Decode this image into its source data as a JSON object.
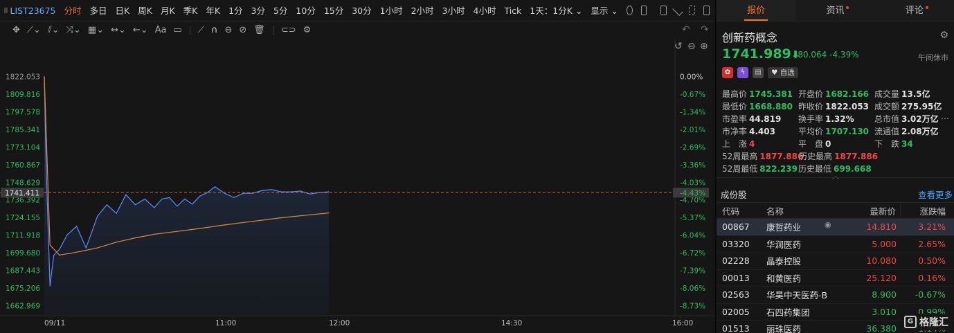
{
  "toolbar": {
    "symbol": "LIST23675",
    "periods": [
      "分时",
      "多日",
      "日K",
      "周K",
      "月K",
      "季K",
      "年K",
      "1分",
      "3分",
      "5分",
      "10分",
      "15分",
      "30分",
      "1小时",
      "2小时",
      "3小时",
      "4小时",
      "Tick"
    ],
    "active_period": "分时",
    "dot_periods": [
      "2小时",
      "Tick"
    ],
    "combo": "1天：1分K",
    "display": "显示"
  },
  "drawing_tools": [
    "move",
    "line",
    "channel",
    "fib",
    "measure",
    "range",
    "arrow",
    "text",
    "comment",
    "ruler",
    "magnet",
    "visibility",
    "hide",
    "delete",
    "link",
    "settings"
  ],
  "chart": {
    "x_labels": [
      "09/11",
      "11:00",
      "12:00",
      "14:30",
      "16:00"
    ],
    "y_labels": [
      "1822.053",
      "1809.816",
      "1797.578",
      "1785.341",
      "1773.104",
      "1760.867",
      "1748.629",
      "1736.392",
      "1724.155",
      "1711.918",
      "1699.680",
      "1687.443",
      "1675.206",
      "1662.969"
    ],
    "pct_labels": [
      "0.00%",
      "-0.67%",
      "-1.34%",
      "-2.01%",
      "-2.69%",
      "-3.36%",
      "-4.03%",
      "-4.70%",
      "-5.37%",
      "-6.04%",
      "-6.72%",
      "-7.39%",
      "-8.06%",
      "-8.73%"
    ],
    "current_price_label": "1741.411",
    "current_pct_label": "-4.43%",
    "colors": {
      "price_line": "#5b8cff",
      "avg_line": "#e08a3a",
      "cur_line": "#d0602a",
      "pos": "#f04848",
      "neg": "#2ebd63"
    }
  },
  "chart_data": {
    "type": "line",
    "title": "",
    "xlabel": "",
    "ylabel": "",
    "ylim": [
      1656.85,
      1828.17
    ],
    "x_ticks": [
      "09/11",
      "11:00",
      "12:00",
      "14:30",
      "16:00"
    ],
    "series": [
      {
        "name": "",
        "x": [
          "09:30",
          "09:31",
          "09:33",
          "09:35",
          "09:38",
          "09:42",
          "09:47",
          "09:52",
          "09:58",
          "10:03",
          "10:08",
          "10:13",
          "10:18",
          "10:23",
          "10:28",
          "10:32",
          "10:36",
          "10:40",
          "10:44",
          "10:48",
          "10:52",
          "10:56",
          "11:00",
          "11:05",
          "11:10",
          "11:15",
          "11:20",
          "11:25",
          "11:30",
          "11:35",
          "11:40",
          "11:45",
          "11:50",
          "11:55",
          "12:00"
        ],
        "values": [
          1822.0,
          1760.0,
          1676.5,
          1698.0,
          1702.0,
          1712.0,
          1718.0,
          1703.0,
          1725.0,
          1733.0,
          1727.0,
          1740.0,
          1733.0,
          1737.0,
          1731.0,
          1737.0,
          1738.0,
          1732.0,
          1737.0,
          1733.5,
          1739.0,
          1741.5,
          1745.5,
          1741.0,
          1738.0,
          1741.0,
          1741.0,
          1743.0,
          1743.5,
          1742.0,
          1742.0,
          1742.5,
          1740.5,
          1741.5,
          1742.0
        ]
      },
      {
        "name": "",
        "x": [
          "09:30",
          "09:33",
          "09:38",
          "09:47",
          "09:58",
          "10:08",
          "10:18",
          "10:28",
          "10:40",
          "10:52",
          "11:05",
          "11:20",
          "11:35",
          "11:50",
          "12:00"
        ],
        "values": [
          1822.0,
          1705.0,
          1698.0,
          1700.0,
          1703.0,
          1707.0,
          1710.0,
          1712.5,
          1714.5,
          1716.5,
          1719.0,
          1721.5,
          1724.0,
          1726.0,
          1727.3
        ]
      }
    ]
  },
  "tabs": [
    {
      "label": "报价",
      "dot": false
    },
    {
      "label": "资讯",
      "dot": true
    },
    {
      "label": "评论",
      "dot": true
    }
  ],
  "quote": {
    "name": "创新药概念",
    "price": "1741.989",
    "change": "-80.064",
    "change_pct": "-4.39%",
    "status": "午间休市",
    "watch_label": "自选",
    "stats": [
      [
        {
          "k": "最高价",
          "v": "1745.381",
          "c": "dn"
        },
        {
          "k": "开盘价",
          "v": "1682.166",
          "c": "dn"
        },
        {
          "k": "成交量",
          "v": "13.5亿",
          "c": "wh"
        }
      ],
      [
        {
          "k": "最低价",
          "v": "1668.880",
          "c": "dn"
        },
        {
          "k": "昨收价",
          "v": "1822.053",
          "c": "wh"
        },
        {
          "k": "成交额",
          "v": "275.95亿",
          "c": "wh"
        }
      ],
      [
        {
          "k": "市盈率",
          "v": "44.819",
          "c": "wh"
        },
        {
          "k": "换手率",
          "v": "1.32%",
          "c": "wh"
        },
        {
          "k": "总市值",
          "v": "3.02万亿",
          "c": "wh"
        }
      ],
      [
        {
          "k": "市净率",
          "v": "4.403",
          "c": "wh"
        },
        {
          "k": "平均价",
          "v": "1707.130",
          "c": "dn"
        },
        {
          "k": "流通值",
          "v": "2.08万亿",
          "c": "wh"
        }
      ],
      [
        {
          "k": "上　涨",
          "v": "4",
          "c": "up"
        },
        {
          "k": "平　盘",
          "v": "0",
          "c": "wh"
        },
        {
          "k": "下　跌",
          "v": "34",
          "c": "dn"
        }
      ],
      [
        {
          "k": "52周最高",
          "v": "1877.886",
          "c": "up"
        },
        {
          "k": "历史最高",
          "v": "1877.886",
          "c": "up"
        },
        {
          "k": "",
          "v": "",
          "c": "wh"
        }
      ],
      [
        {
          "k": "52周最低",
          "v": "822.239",
          "c": "dn"
        },
        {
          "k": "历史最低",
          "v": "699.668",
          "c": "dn"
        },
        {
          "k": "",
          "v": "",
          "c": "wh"
        }
      ]
    ]
  },
  "constituents": {
    "title": "成份股",
    "more": "查看更多",
    "headers": [
      "代码",
      "名称",
      "最新价",
      "涨跌幅"
    ],
    "rows": [
      {
        "code": "00867",
        "name": "康哲药业",
        "price": "14.810",
        "pct": "3.21%",
        "c": "up",
        "sel": true
      },
      {
        "code": "03320",
        "name": "华润医药",
        "price": "5.000",
        "pct": "2.65%",
        "c": "up",
        "sel": false
      },
      {
        "code": "02228",
        "name": "晶泰控股",
        "price": "10.080",
        "pct": "0.50%",
        "c": "up",
        "sel": false
      },
      {
        "code": "00013",
        "name": "和黄医药",
        "price": "25.120",
        "pct": "0.16%",
        "c": "up",
        "sel": false
      },
      {
        "code": "02563",
        "name": "华昊中天医药-B",
        "price": "8.900",
        "pct": "-0.67%",
        "c": "dn",
        "sel": false
      },
      {
        "code": "02005",
        "name": "石四药集团",
        "price": "3.010",
        "pct": "0.99%",
        "c": "dn",
        "sel": false
      },
      {
        "code": "01513",
        "name": "丽珠医药",
        "price": "36.380",
        "pct": "-1.14%",
        "c": "dn",
        "sel": false
      }
    ]
  },
  "logo_text": "格隆汇"
}
